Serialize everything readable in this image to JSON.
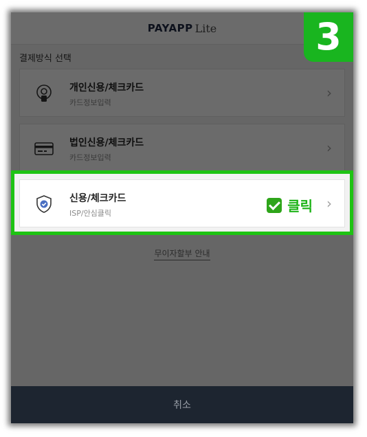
{
  "header": {
    "logo_main": "PAYAPP",
    "logo_lite": "Lite"
  },
  "section_title": "결제방식 선택",
  "payment_options": [
    {
      "title": "개인신용/체크카드",
      "subtitle": "카드정보입력",
      "icon": "person-id-icon"
    },
    {
      "title": "법인신용/체크카드",
      "subtitle": "카드정보입력",
      "icon": "credit-card-icon"
    },
    {
      "title": "신용/체크카드",
      "subtitle": "ISP/안심클릭",
      "icon": "shield-check-icon"
    }
  ],
  "installment_guide": "무이자할부 안내",
  "cancel_label": "취소",
  "step_badge": "3",
  "click_annotation": "클릭",
  "chevron": "›",
  "colors": {
    "highlight": "#1ec313",
    "badge": "#19b51f",
    "footer": "#1d2530"
  }
}
